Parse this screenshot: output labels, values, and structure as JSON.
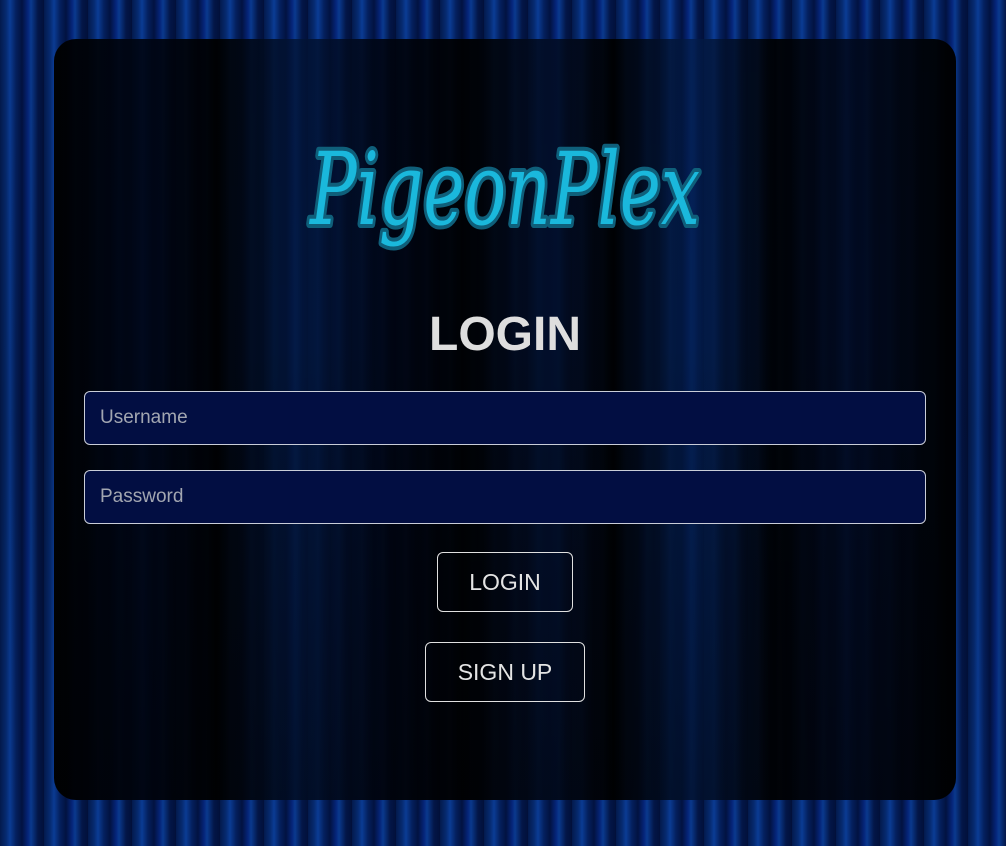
{
  "brand": {
    "logo_text": "PigeonPlex",
    "logo_color": "#1ab8dc",
    "logo_outline_color": "#0f5f7a"
  },
  "login": {
    "heading": "LOGIN",
    "username_placeholder": "Username",
    "username_value": "",
    "password_placeholder": "Password",
    "password_value": "",
    "login_button": "LOGIN",
    "signup_button": "SIGN UP"
  },
  "theme": {
    "background": "#031a4d",
    "input_background": "#020e42",
    "text_color": "#dedede"
  }
}
